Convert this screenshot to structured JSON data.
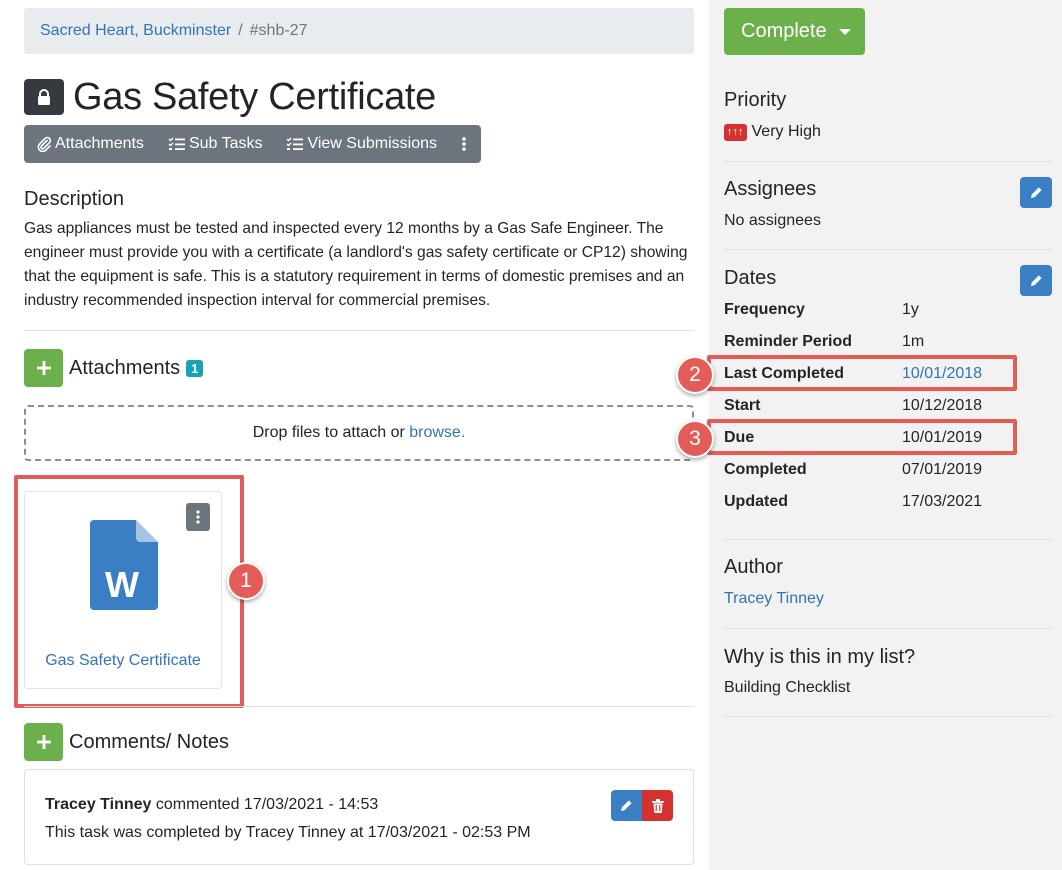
{
  "breadcrumb": {
    "parent": "Sacred Heart, Buckminster",
    "separator": "/",
    "current": "#shb-27"
  },
  "title": "Gas Safety Certificate",
  "toolbar": {
    "attachments": "Attachments",
    "sub_tasks": "Sub Tasks",
    "view_submissions": "View Submissions"
  },
  "description": {
    "heading": "Description",
    "text": "Gas appliances must be tested and inspected every 12 months by a Gas Safe Engineer. The engineer must provide you with a certificate (a landlord's gas safety certificate or CP12) showing that the equipment is safe. This is a statutory requirement in terms of domestic premises and an industry recommended inspection interval for commercial premises."
  },
  "attachments": {
    "heading": "Attachments",
    "count": "1",
    "dropzone_text": "Drop files to attach or ",
    "dropzone_link": "browse.",
    "file": {
      "name": "Gas Safety Certificate",
      "icon": "word-document-icon",
      "icon_letter": "W"
    }
  },
  "comments": {
    "heading": "Comments/ Notes",
    "items": [
      {
        "author": "Tracey Tinney",
        "meta": " commented 17/03/2021 - 14:53",
        "text": "This task was completed by Tracey Tinney at 17/03/2021 - 02:53 PM"
      }
    ]
  },
  "sidebar": {
    "complete_button": "Complete",
    "priority": {
      "heading": "Priority",
      "badge": "↑↑↑",
      "value": "Very High"
    },
    "assignees": {
      "heading": "Assignees",
      "value": "No assignees"
    },
    "dates": {
      "heading": "Dates",
      "rows": [
        {
          "label": "Frequency",
          "value": "1y"
        },
        {
          "label": "Reminder Period",
          "value": "1m"
        },
        {
          "label": "Last Completed",
          "value": "10/01/2018"
        },
        {
          "label": "Start",
          "value": "10/12/2018"
        },
        {
          "label": "Due",
          "value": "10/01/2019"
        },
        {
          "label": "Completed",
          "value": "07/01/2019"
        },
        {
          "label": "Updated",
          "value": "17/03/2021"
        }
      ]
    },
    "author": {
      "heading": "Author",
      "value": "Tracey Tinney"
    },
    "why": {
      "heading": "Why is this in my list?",
      "value": "Building Checklist"
    }
  },
  "markers": [
    "1",
    "2",
    "3"
  ],
  "colors": {
    "accent_green": "#6cb04c",
    "link_blue": "#3273b7",
    "highlight_red": "#e35d58",
    "danger_red": "#d3322e",
    "info_teal": "#17a2b8"
  }
}
